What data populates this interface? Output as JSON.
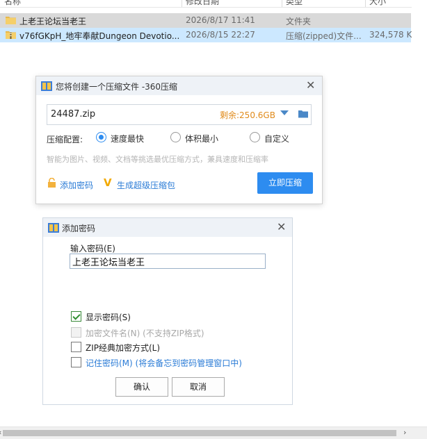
{
  "explorer": {
    "columns": [
      "名称",
      "修改日期",
      "类型",
      "大小"
    ],
    "rows": [
      {
        "name": "上老王论坛当老王",
        "date": "2026/8/17 11:41",
        "type": "文件夹",
        "size": "",
        "icon": "folder-icon"
      },
      {
        "name": "v76fGKpH_地牢奉献Dungeon Devotio...",
        "date": "2026/8/15 22:27",
        "type": "压缩(zipped)文件...",
        "size": "324,578 K",
        "icon": "zip-folder-icon"
      }
    ]
  },
  "compress_dialog": {
    "title": "您将创建一个压缩文件 -360压缩",
    "filename": "24487.zip",
    "free_space": "剩余:250.6GB",
    "config_label": "压缩配置:",
    "options": [
      "速度最快",
      "体积最小",
      "自定义"
    ],
    "selected_option": "速度最快",
    "hint": "智能为图片、视频、文档等挑选最优压缩方式，兼具速度和压缩率",
    "add_password": "添加密码",
    "super_pack": "生成超级压缩包",
    "submit": "立即压缩"
  },
  "password_dialog": {
    "title": "添加密码",
    "input_label": "输入密码(E)",
    "password_value": "上老王论坛当老王",
    "checkboxes": [
      {
        "label": "显示密码(S)",
        "checked": true,
        "disabled": false
      },
      {
        "label": "加密文件名(N) (不支持ZIP格式)",
        "checked": false,
        "disabled": true
      },
      {
        "label": "ZIP经典加密方式(L)",
        "checked": false,
        "disabled": false
      },
      {
        "label": "记住密码(M) (将会备忘到密码管理窗口中)",
        "checked": false,
        "disabled": false
      }
    ],
    "ok": "确认",
    "cancel": "取消"
  },
  "colors": {
    "accent": "#2d8cf0",
    "free_space": "#e08a1a",
    "selection": "#cce8ff",
    "link": "#2a7bd6"
  }
}
